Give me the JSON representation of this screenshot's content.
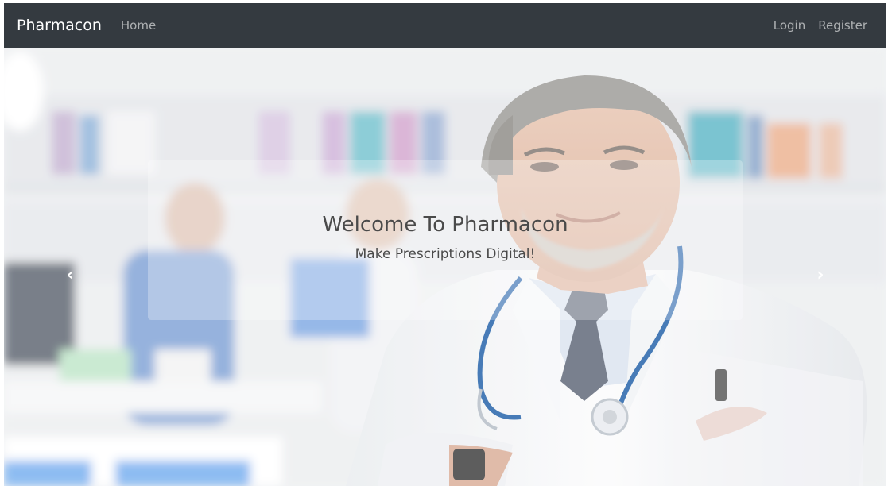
{
  "navbar": {
    "brand": "Pharmacon",
    "home_label": "Home",
    "login_label": "Login",
    "register_label": "Register"
  },
  "hero": {
    "title": "Welcome To Pharmacon",
    "subtitle": "Make Prescriptions Digital!",
    "prev_icon": "chevron-left-icon",
    "next_icon": "chevron-right-icon"
  },
  "colors": {
    "navbar_bg": "#343a40",
    "brand_text": "#ffffff",
    "nav_link": "rgba(255,255,255,0.6)",
    "caption_text": "#4a4a4a"
  }
}
